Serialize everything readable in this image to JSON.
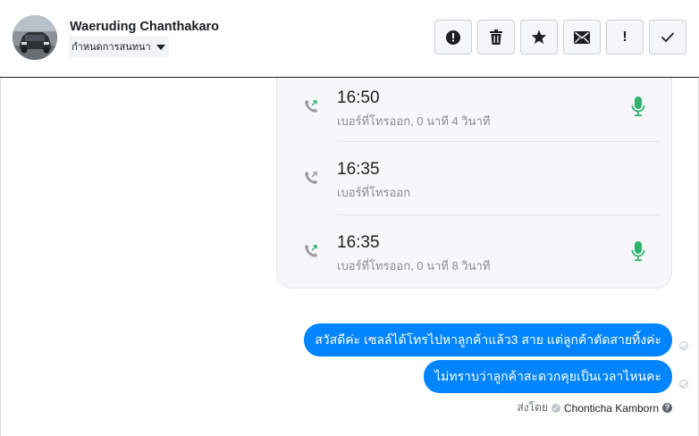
{
  "header": {
    "contact_name": "Waeruding Chanthakaro",
    "conversation_label": "กำหนดการสนทนา",
    "actions": [
      {
        "icon": "alert-circle-icon",
        "label": ""
      },
      {
        "icon": "trash-icon",
        "label": ""
      },
      {
        "icon": "star-icon",
        "label": ""
      },
      {
        "icon": "mail-icon",
        "label": ""
      },
      {
        "icon": "exclamation-icon",
        "label": "!"
      },
      {
        "icon": "checkmark-icon",
        "label": ""
      }
    ]
  },
  "call_log": [
    {
      "time": "16:50",
      "description": "เบอร์ที่โทรออก, 0 นาที 4 วินาที",
      "has_recording": true
    },
    {
      "time": "16:35",
      "description": "เบอร์ที่โทรออก",
      "has_recording": false
    },
    {
      "time": "16:35",
      "description": "เบอร์ที่โทรออก, 0 นาที 8 วินาที",
      "has_recording": true
    }
  ],
  "messages": [
    {
      "text": "สวัสดีค่ะ เซลล์ได้โทรไปหาลูกค้าแล้ว3 สาย แต่ลูกค้าตัดสายทิ้งค่ะ"
    },
    {
      "text": "ไม่ทราบว่าลูกค้าสะดวกคุยเป็นเวลาไหนคะ"
    }
  ],
  "sent_by": {
    "prefix": "ส่งโดย",
    "agent": "Chonticha Kamborn",
    "help": "?"
  },
  "colors": {
    "bubble": "#0084ff",
    "mic": "#2fb36d",
    "phone": "#9a9aa0"
  }
}
